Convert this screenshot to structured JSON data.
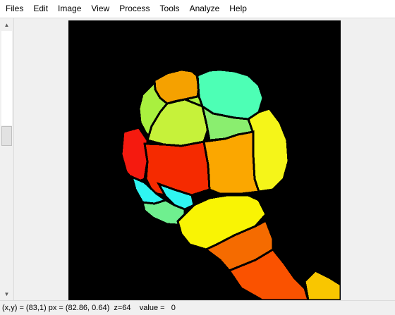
{
  "menu": {
    "items": [
      "Files",
      "Edit",
      "Image",
      "View",
      "Process",
      "Tools",
      "Analyze",
      "Help"
    ]
  },
  "status": {
    "coords": "(x,y) = (83,1) px = (82.86, 0.64)",
    "z": "z=64",
    "value": "value =   0"
  },
  "canvas": {
    "background": "#000000",
    "segment_colors": {
      "lime": "#a9f03f",
      "orange_top": "#f5a100",
      "aquamarine": "#4dffb5",
      "yellow_green": "#c6f23a",
      "light_green": "#8aee6f",
      "yellow": "#f5f519",
      "red": "#f51a0f",
      "red_orange": "#f52a00",
      "orange": "#fba700",
      "cyan": "#2ff5f2",
      "sea_green": "#6ff08f",
      "yellow_stem": "#f9f404",
      "dark_orange": "#f56b00",
      "deep_orange": "#fa5200",
      "gold": "#f9c600"
    }
  }
}
